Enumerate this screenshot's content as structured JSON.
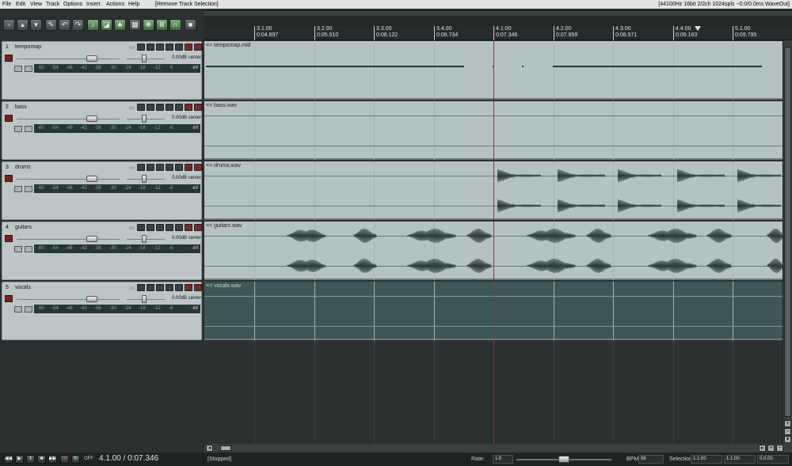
{
  "menu": {
    "items": [
      "File",
      "Edit",
      "View",
      "Track",
      "Options",
      "Insert",
      "Actions",
      "Help"
    ],
    "last_action": "[Remove Track Selection]",
    "audio_status": "[44100Hz 16bit 2/2ch 1024spls ~0.0/0.0ms WaveOut]"
  },
  "toolbar": {
    "icons": [
      "new-project-icon",
      "open-project-icon",
      "save-project-icon",
      "project-settings-icon",
      "undo-icon",
      "redo-icon",
      "metronome-icon",
      "ripple-edit-icon",
      "snap-icon",
      "grid-icon",
      "envelope-lock-icon",
      "mixer-icon",
      "headphones-icon",
      "lock-icon"
    ]
  },
  "ruler": {
    "marks": [
      {
        "bar": "3.1.00",
        "time": "0:04.897"
      },
      {
        "bar": "3.2.00",
        "time": "0:05.510"
      },
      {
        "bar": "3.3.00",
        "time": "0:06.122"
      },
      {
        "bar": "3.4.00",
        "time": "0:06.734"
      },
      {
        "bar": "4.1.00",
        "time": "0:07.346"
      },
      {
        "bar": "4.2.00",
        "time": "0:07.959"
      },
      {
        "bar": "4.3.00",
        "time": "0:08.571"
      },
      {
        "bar": "4.4.00",
        "time": "0:09.183"
      },
      {
        "bar": "5.1.00",
        "time": "0:09.795"
      }
    ]
  },
  "tracks": [
    {
      "number": "1",
      "name": "tempomap",
      "volume": "0.00dB",
      "pan": "center",
      "meter_end": "-inf",
      "item": "<< tempomap.mid"
    },
    {
      "number": "2",
      "name": "bass",
      "volume": "0.00dB",
      "pan": "center",
      "meter_end": "-inf",
      "item": "<< bass.wav"
    },
    {
      "number": "3",
      "name": "drums",
      "volume": "0.00dB",
      "pan": "center",
      "meter_end": "-inf",
      "item": "<< drums.wav"
    },
    {
      "number": "4",
      "name": "guitars",
      "volume": "0.00dB",
      "pan": "center",
      "meter_end": "-inf",
      "item": "<< guitars.wav"
    },
    {
      "number": "5",
      "name": "vocals",
      "volume": "0.00dB",
      "pan": "center",
      "meter_end": "-inf",
      "item": "<< vocals.wav"
    }
  ],
  "meter_ticks": [
    "-60",
    "-54",
    "-48",
    "-42",
    "-36",
    "-30",
    "-24",
    "-18",
    "-12",
    "-6"
  ],
  "transport": {
    "position": "4.1.00 / 0:07.346",
    "state": "[Stopped]",
    "rate_label": "Rate:",
    "rate": "1.0",
    "bpm_label": "BPM:",
    "bpm": "98",
    "selection_label": "Selection:",
    "sel_start": "1.1.00",
    "sel_end": "1.1.00",
    "sel_length": "0.0.00",
    "repeat": "OFF"
  },
  "colors": {
    "track_panel": "#bdc6c6",
    "item_bg": "#b6c2c2",
    "selected_item_bg": "#3e5656",
    "edit_cursor": "#a03030",
    "background": "#2b3030"
  }
}
